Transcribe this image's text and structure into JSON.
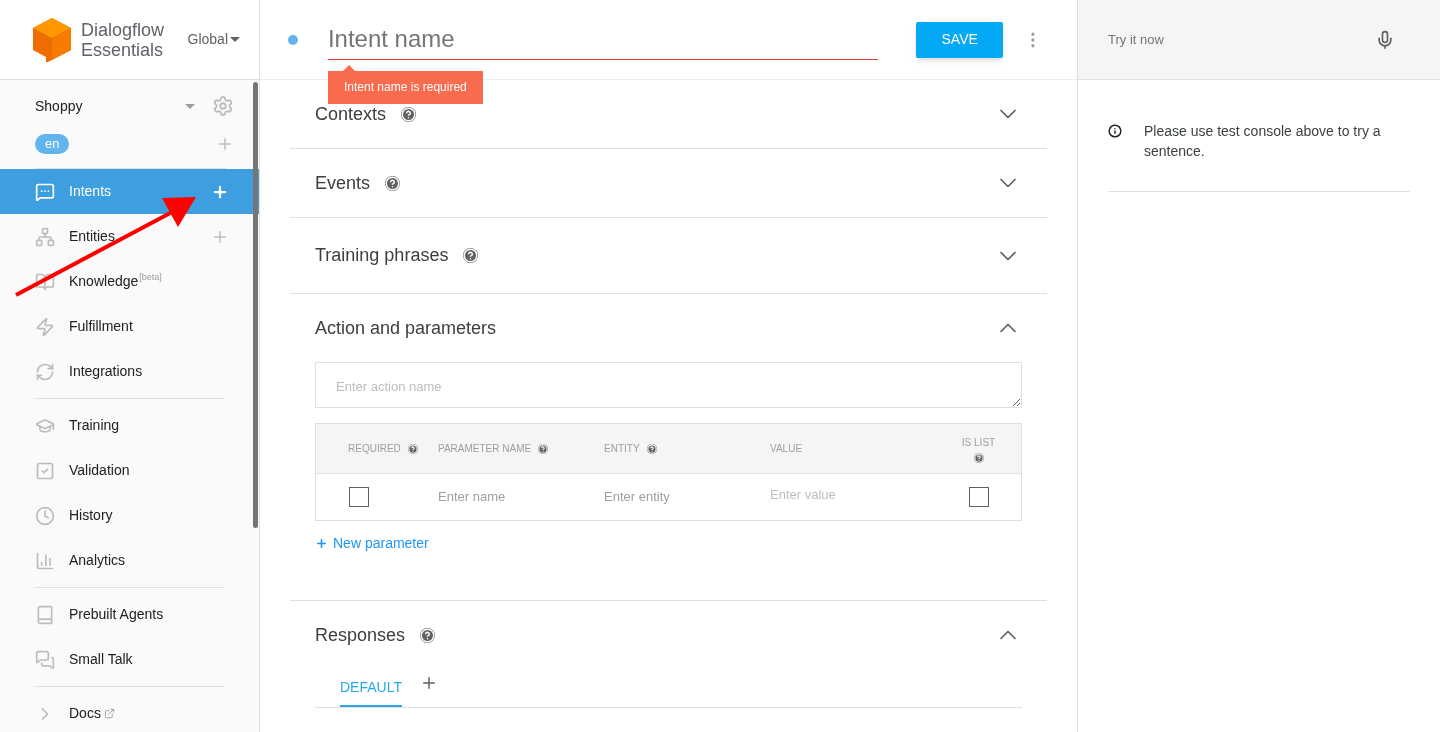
{
  "brand": {
    "line1": "Dialogflow",
    "line2": "Essentials",
    "region": "Global"
  },
  "agent": {
    "name": "Shoppy",
    "language": "en"
  },
  "nav": [
    [
      {
        "label": "Intents",
        "selected": true,
        "add": true
      },
      {
        "label": "Entities",
        "selected": false,
        "add": true
      },
      {
        "label": "Knowledge",
        "tag": "[beta]",
        "selected": false,
        "add": false
      },
      {
        "label": "Fulfillment",
        "selected": false,
        "add": false
      },
      {
        "label": "Integrations",
        "selected": false,
        "add": false
      }
    ],
    [
      {
        "label": "Training",
        "selected": false,
        "add": false
      },
      {
        "label": "Validation",
        "selected": false,
        "add": false
      },
      {
        "label": "History",
        "selected": false,
        "add": false
      },
      {
        "label": "Analytics",
        "selected": false,
        "add": false
      }
    ],
    [
      {
        "label": "Prebuilt Agents",
        "selected": false,
        "add": false
      },
      {
        "label": "Small Talk",
        "selected": false,
        "add": false
      }
    ],
    [
      {
        "label": "Docs",
        "selected": false,
        "add": false,
        "external": true
      }
    ]
  ],
  "intent": {
    "placeholder": "Intent name",
    "error": "Intent name is required",
    "save": "SAVE"
  },
  "sections": [
    {
      "title": "Contexts",
      "help": true,
      "expanded": false
    },
    {
      "title": "Events",
      "help": true,
      "expanded": false
    },
    {
      "title": "Training phrases",
      "help": true,
      "expanded": false
    },
    {
      "title": "Action and parameters",
      "help": false,
      "expanded": true,
      "parameters": {
        "action_placeholder": "Enter action name",
        "columns": [
          {
            "label": "REQUIRED",
            "help": true
          },
          {
            "label": "PARAMETER NAME",
            "help": true
          },
          {
            "label": "ENTITY",
            "help": true
          },
          {
            "label": "VALUE",
            "help": false
          },
          {
            "label": "IS LIST",
            "help": true
          }
        ],
        "rows": [
          {
            "required": false,
            "name_placeholder": "Enter name",
            "entity_placeholder": "Enter entity",
            "value_placeholder": "Enter value",
            "is_list": false
          }
        ],
        "new_parameter": "New parameter"
      }
    },
    {
      "title": "Responses",
      "help": true,
      "expanded": true,
      "tabs": [
        {
          "label": "DEFAULT",
          "selected": true
        }
      ]
    }
  ],
  "console": {
    "placeholder": "Try it now",
    "message": "Please use test console above to try a sentence."
  }
}
